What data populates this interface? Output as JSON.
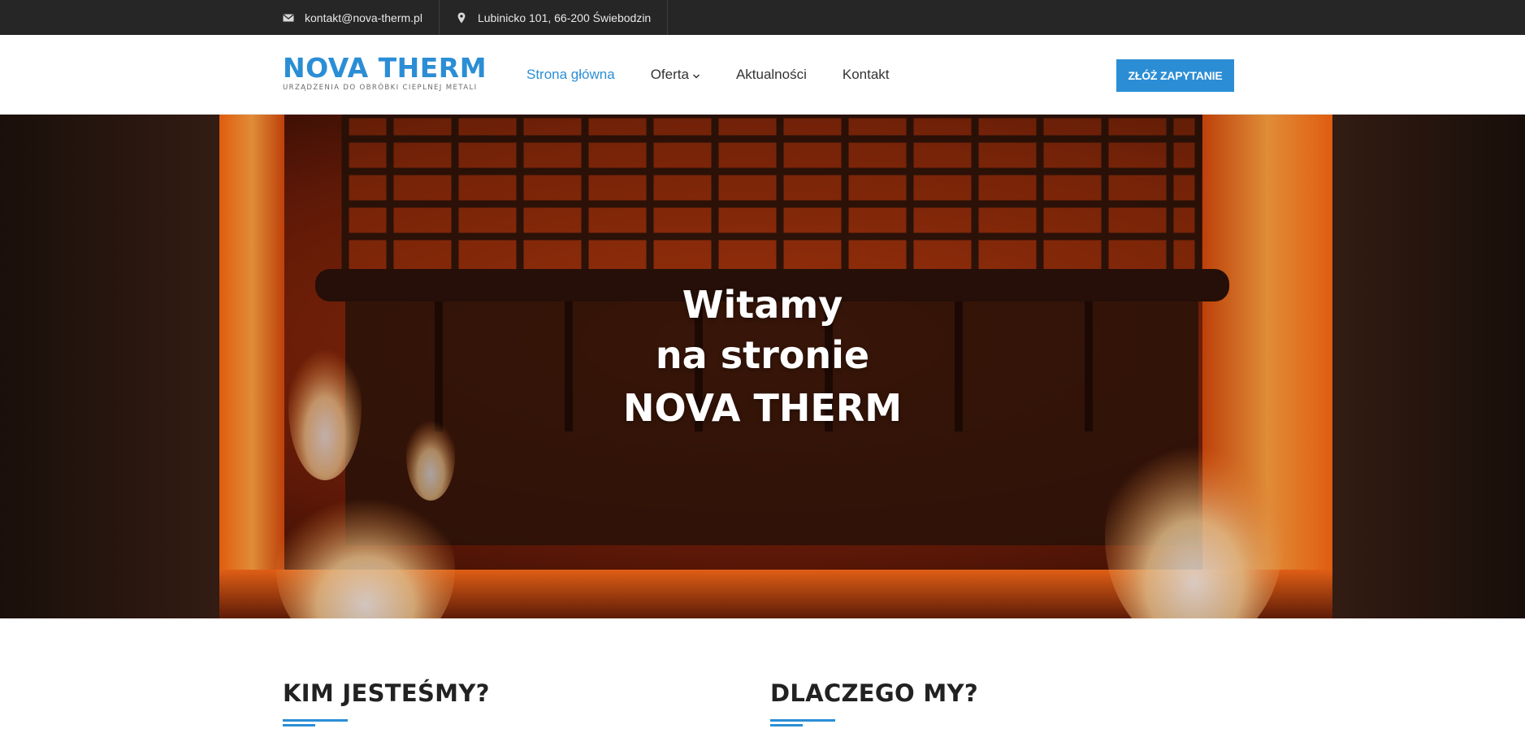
{
  "topbar": {
    "email": "kontakt@nova-therm.pl",
    "email_icon": "envelope-icon",
    "address": "Lubinicko 101, 66-200 Świebodzin",
    "address_icon": "map-marker-icon"
  },
  "header": {
    "logo": {
      "name": "NOVA THERM",
      "tagline": "URZĄDZENIA DO OBRÓBKI CIEPLNEJ METALI"
    },
    "nav": [
      {
        "label": "Strona główna",
        "active": true
      },
      {
        "label": "Oferta",
        "has_dropdown": true
      },
      {
        "label": "Aktualności"
      },
      {
        "label": "Kontakt"
      }
    ],
    "cta_label": "ZŁÓŻ ZAPYTANIE"
  },
  "hero": {
    "line1": "Witamy",
    "line2": "na stronie",
    "line3": "NOVA THERM"
  },
  "sections": [
    {
      "title": "KIM JESTEŚMY?"
    },
    {
      "title": "DLACZEGO MY?"
    }
  ],
  "colors": {
    "brand": "#2b8ed5",
    "topbar_bg": "#262626",
    "heading": "#222222"
  }
}
